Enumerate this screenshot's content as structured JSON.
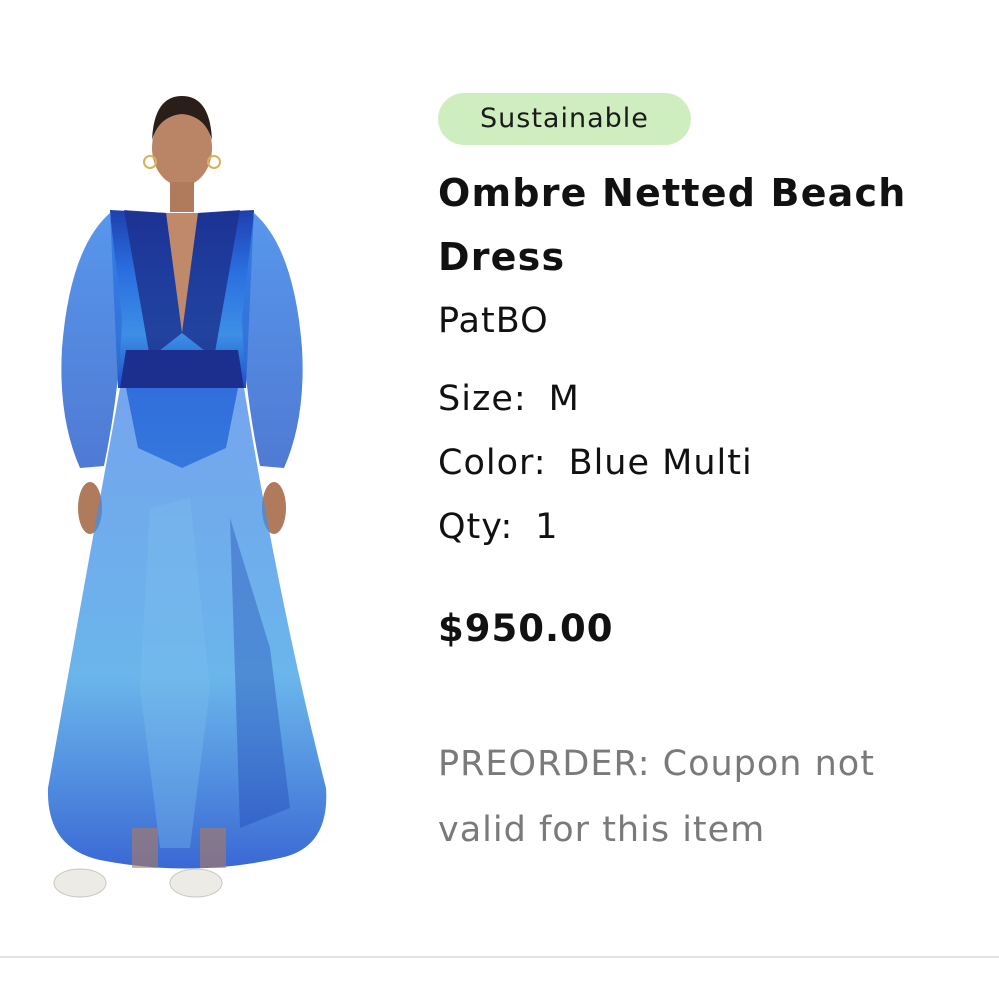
{
  "item": {
    "badge": "Sustainable",
    "title": "Ombre Netted Beach Dress",
    "brand": "PatBO",
    "size_label": "Size:",
    "size_value": "M",
    "color_label": "Color:",
    "color_value": "Blue Multi",
    "qty_label": "Qty:",
    "qty_value": "1",
    "price": "$950.00",
    "note": "PREORDER: Coupon not valid for this item",
    "image_icon": "dress-photo"
  },
  "colors": {
    "badge_bg": "#cfeec0",
    "dress_primary": "#2f6fd6",
    "dress_dark": "#1c2f8f",
    "note_text": "#7a7a7a"
  }
}
